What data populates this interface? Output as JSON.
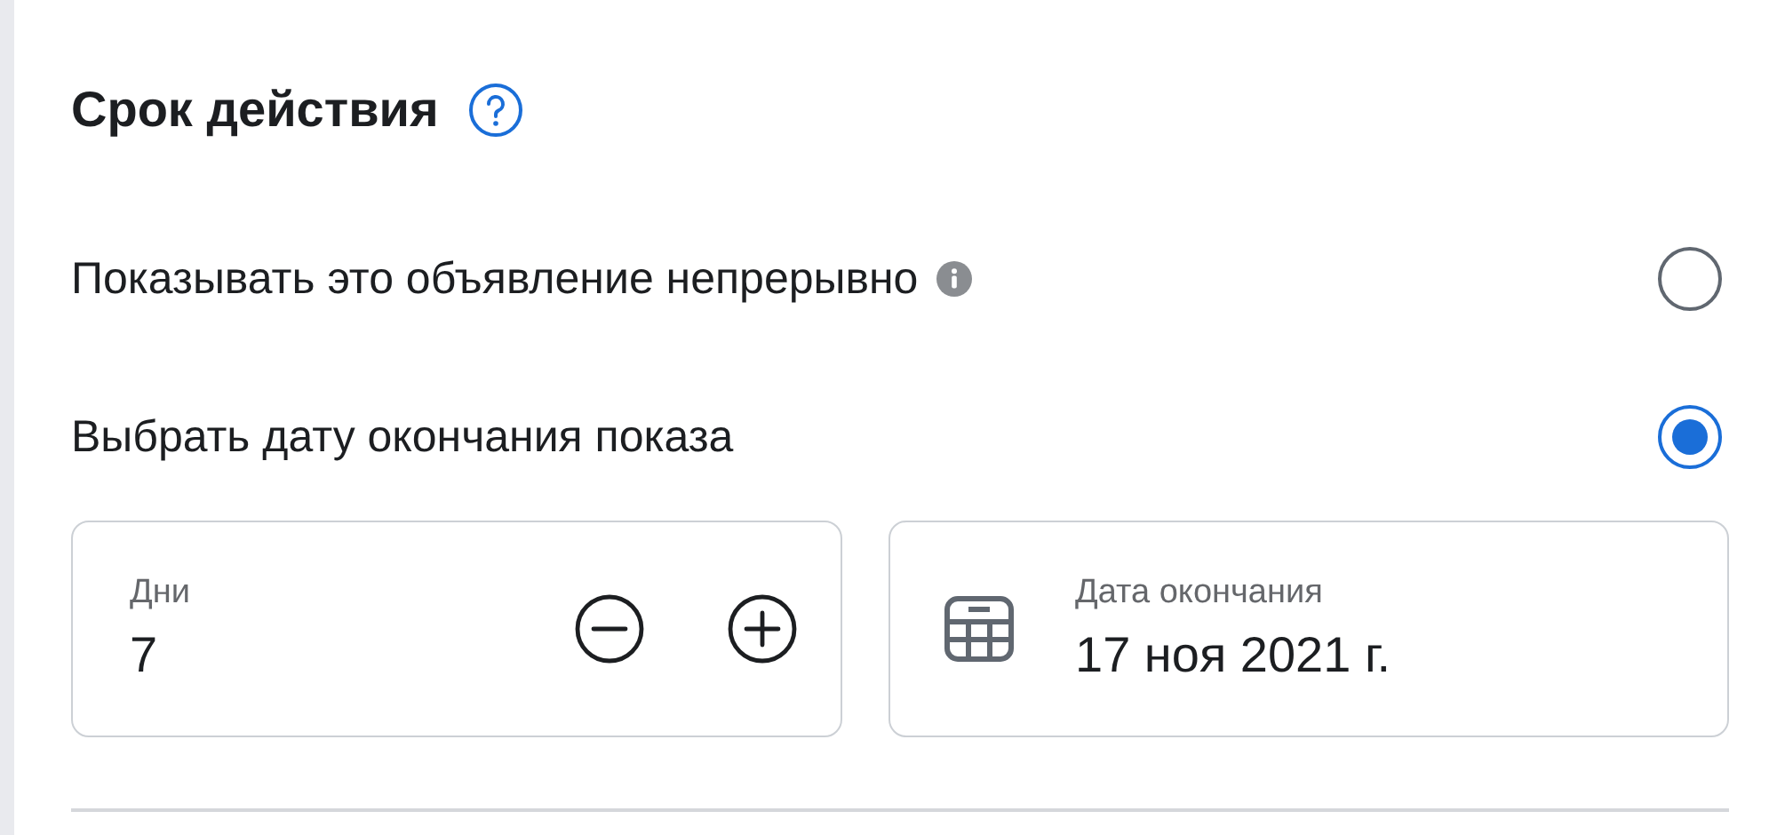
{
  "section": {
    "title": "Срок действия"
  },
  "options": [
    {
      "label": "Показывать это объявление непрерывно",
      "info": true,
      "selected": false
    },
    {
      "label": "Выбрать дату окончания показа",
      "info": false,
      "selected": true
    }
  ],
  "days_field": {
    "label": "Дни",
    "value": "7"
  },
  "end_date_field": {
    "label": "Дата окончания",
    "value": "17 ноя 2021 г."
  }
}
